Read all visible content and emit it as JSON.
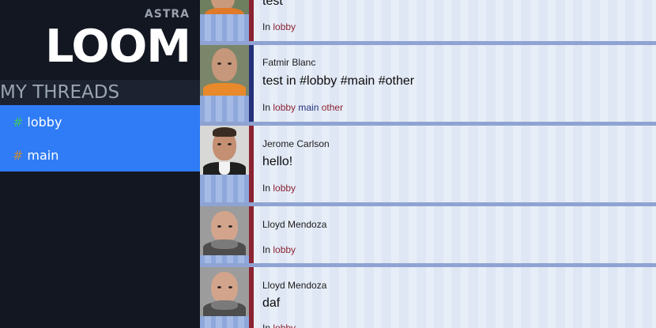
{
  "brand": {
    "small": "ASTRA",
    "big": "LOOM"
  },
  "sidebar": {
    "header": "MY THREADS",
    "items": [
      {
        "hash": "#",
        "label": "lobby"
      },
      {
        "hash": "#",
        "label": "main"
      }
    ]
  },
  "feed": {
    "in_label": "In",
    "posts": [
      {
        "author": "",
        "message": "test",
        "tags": [
          "lobby"
        ]
      },
      {
        "author": "Fatmir Blanc",
        "message": "test in #lobby #main #other",
        "tags": [
          "lobby",
          "main",
          "other"
        ]
      },
      {
        "author": "Jerome Carlson",
        "message": "hello!",
        "tags": [
          "lobby"
        ]
      },
      {
        "author": "Lloyd Mendoza",
        "message": "",
        "tags": [
          "lobby"
        ]
      },
      {
        "author": "Lloyd Mendoza",
        "message": "daf",
        "tags": [
          "lobby"
        ]
      }
    ]
  },
  "colors": {
    "sidebar_bg": "#131722",
    "active_threads_bg": "#2f7cf6",
    "bar_red": "#8b2332",
    "bar_navy": "#24307a",
    "separator": "#8fa3d3"
  }
}
